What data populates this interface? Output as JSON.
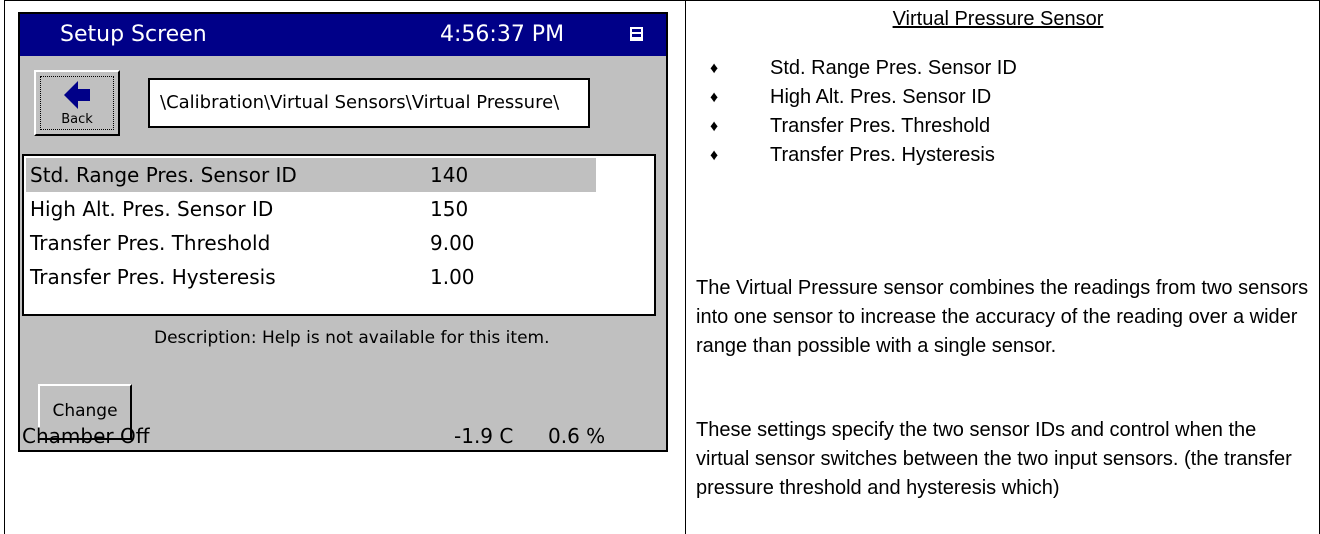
{
  "device": {
    "title": "Setup Screen",
    "clock": "4:56:37 PM",
    "back_label": "Back",
    "path": "\\Calibration\\Virtual Sensors\\Virtual Pressure\\",
    "rows": [
      {
        "name": "Std. Range Pres. Sensor ID",
        "value": "140",
        "selected": true
      },
      {
        "name": "High Alt. Pres. Sensor ID",
        "value": "150",
        "selected": false
      },
      {
        "name": "Transfer Pres. Threshold",
        "value": "9.00",
        "selected": false
      },
      {
        "name": "Transfer Pres. Hysteresis",
        "value": "1.00",
        "selected": false
      }
    ],
    "description": "Description:  Help is not available for this item.",
    "change_label": "Change",
    "status": {
      "chamber": "Chamber Off",
      "temperature": "-1.9 C",
      "humidity": "0.6 %"
    },
    "colors": {
      "titlebar": "#000088",
      "face": "#c0c0c0"
    }
  },
  "doc": {
    "heading": "Virtual Pressure Sensor",
    "bullets": [
      "Std. Range Pres. Sensor ID",
      "High Alt. Pres. Sensor ID",
      "Transfer Pres. Threshold",
      "Transfer Pres. Hysteresis"
    ],
    "bullet_symbol": "♦",
    "paragraph1": "The Virtual Pressure sensor combines the readings from two sensors into one sensor to increase the accuracy of the reading over a wider range than possible with a single sensor.",
    "paragraph2": "These settings specify the two sensor IDs and control when the virtual sensor switches between the two input sensors. (the transfer pressure threshold and hysteresis which)"
  }
}
